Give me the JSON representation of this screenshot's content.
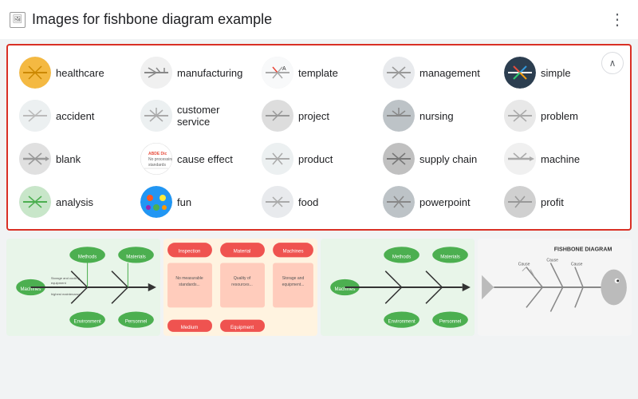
{
  "header": {
    "title": "Images for fishbone diagram example",
    "icon_label": "image-icon",
    "more_icon": "⋮"
  },
  "collapse_button": {
    "icon": "∧"
  },
  "tags": [
    {
      "id": "healthcare",
      "label": "healthcare",
      "thumb_class": "thumb-healthcare",
      "color": "#f4b942"
    },
    {
      "id": "manufacturing",
      "label": "manufacturing",
      "thumb_class": "thumb-manufacturing",
      "color": "#ecf0f1"
    },
    {
      "id": "template",
      "label": "template",
      "thumb_class": "thumb-template",
      "color": "#f8f9fa"
    },
    {
      "id": "management",
      "label": "management",
      "thumb_class": "thumb-management",
      "color": "#e8eaed"
    },
    {
      "id": "simple",
      "label": "simple",
      "thumb_class": "thumb-simple",
      "color": "#2c3e50"
    },
    {
      "id": "accident",
      "label": "accident",
      "thumb_class": "thumb-accident",
      "color": "#ecf0f1"
    },
    {
      "id": "customer-service",
      "label": "customer service",
      "thumb_class": "thumb-customer-service",
      "color": "#ecf0f1"
    },
    {
      "id": "project",
      "label": "project",
      "thumb_class": "thumb-project",
      "color": "#ecf0f1"
    },
    {
      "id": "nursing",
      "label": "nursing",
      "thumb_class": "thumb-nursing",
      "color": "#bdc3c7"
    },
    {
      "id": "problem",
      "label": "problem",
      "thumb_class": "thumb-problem",
      "color": "#ecf0f1"
    },
    {
      "id": "blank",
      "label": "blank",
      "thumb_class": "thumb-blank",
      "color": "#ecf0f1"
    },
    {
      "id": "cause-effect",
      "label": "cause effect",
      "thumb_class": "thumb-cause-effect",
      "color": "#f8f9fa"
    },
    {
      "id": "product",
      "label": "product",
      "thumb_class": "thumb-product",
      "color": "#ecf0f1"
    },
    {
      "id": "supply-chain",
      "label": "supply chain",
      "thumb_class": "thumb-supply-chain",
      "color": "#bdc3c7"
    },
    {
      "id": "machine",
      "label": "machine",
      "thumb_class": "thumb-machine",
      "color": "#f0f0f0"
    },
    {
      "id": "analysis",
      "label": "analysis",
      "thumb_class": "thumb-analysis",
      "color": "#c8e6c9"
    },
    {
      "id": "fun",
      "label": "fun",
      "thumb_class": "thumb-fun",
      "color": "#2196f3"
    },
    {
      "id": "food",
      "label": "food",
      "thumb_class": "thumb-food",
      "color": "#e8eaed"
    },
    {
      "id": "powerpoint",
      "label": "powerpoint",
      "thumb_class": "thumb-powerpoint",
      "color": "#bdc3c7"
    },
    {
      "id": "profit",
      "label": "profit",
      "thumb_class": "thumb-profit",
      "color": "#e0e0e0"
    }
  ],
  "bottom_images": [
    {
      "id": "img1",
      "type": "green-fishbone"
    },
    {
      "id": "img2",
      "type": "red-flowchart"
    },
    {
      "id": "img3",
      "type": "green-fishbone2"
    },
    {
      "id": "img4",
      "type": "white-fishbone"
    }
  ]
}
